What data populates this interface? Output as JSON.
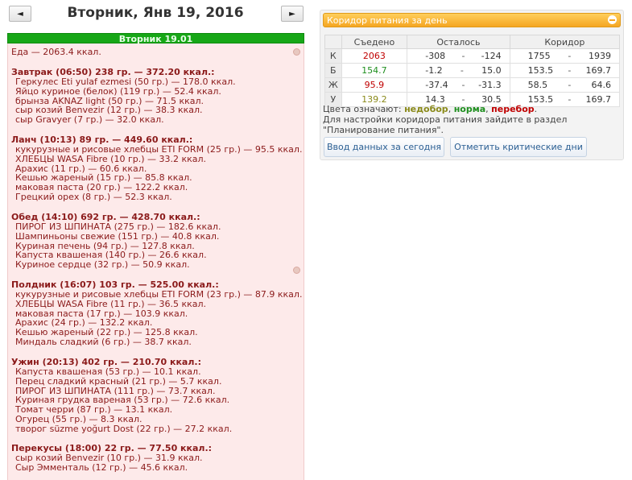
{
  "nav": {
    "prev_symbol": "◄",
    "next_symbol": "►",
    "title": "Вторник, Янв 19, 2016"
  },
  "day": {
    "header": "Вторник 19.01",
    "total": "Еда — 2063.4 ккал.",
    "meals": [
      {
        "title": "Завтрак (06:50) 238 гр. — 372.20 ккал.:",
        "items": [
          "Геркулес Eti yulaf ezmesi (50 гр.) — 178.0 ккал.",
          "Яйцо куриное (белок) (119 гр.) — 52.4 ккал.",
          "брынза AKNAZ light (50 гр.) — 71.5 ккал.",
          "сыр козий Benvezir (12 гр.) — 38.3 ккал.",
          "сыр Gravyer (7 гр.) — 32.0 ккал."
        ]
      },
      {
        "title": "Ланч (10:13) 89 гр. — 449.60 ккал.:",
        "items": [
          "кукурузные и рисовые хлебцы ETI FORM (25 гр.) — 95.5 ккал.",
          "ХЛЕБЦЫ WASA Fibre (10 гр.) — 33.2 ккал.",
          "Арахис (11 гр.) — 60.6 ккал.",
          "Кешью жареный (15 гр.) — 85.8 ккал.",
          "маковая паста (20 гр.) — 122.2 ккал.",
          "Грецкий орех (8 гр.) — 52.3 ккал."
        ]
      },
      {
        "title": "Обед (14:10) 692 гр. — 428.70 ккал.:",
        "items": [
          "ПИРОГ ИЗ ШПИНАТА (275 гр.) — 182.6 ккал.",
          "Шампиньоны свежие (151 гр.) — 40.8 ккал.",
          "Куриная печень (94 гр.) — 127.8 ккал.",
          "Капуста квашеная (140 гр.) — 26.6 ккал.",
          "Куриное сердце (32 гр.) — 50.9 ккал."
        ]
      },
      {
        "title": "Полдник (16:07) 103 гр. — 525.00 ккал.:",
        "items": [
          "кукурузные и рисовые хлебцы ETI FORM (23 гр.) — 87.9 ккал.",
          "ХЛЕБЦЫ WASA Fibre (11 гр.) — 36.5 ккал.",
          "маковая паста (17 гр.) — 103.9 ккал.",
          "Арахис (24 гр.) — 132.2 ккал.",
          "Кешью жареный (22 гр.) — 125.8 ккал.",
          "Миндаль сладкий (6 гр.) — 38.7 ккал."
        ]
      },
      {
        "title": "Ужин (20:13) 402 гр. — 210.70 ккал.:",
        "items": [
          "Капуста квашеная (53 гр.) — 10.1 ккал.",
          "Перец сладкий красный (21 гр.) — 5.7 ккал.",
          "ПИРОГ ИЗ ШПИНАТА (111 гр.) — 73.7 ккал.",
          "Куриная грудка вареная (53 гр.) — 72.6 ккал.",
          "Томат черри (87 гр.) — 13.1 ккал.",
          "Огурец (55 гр.) — 8.3 ккал.",
          "творог süzme yoğurt Dost (22 гр.) — 27.2 ккал."
        ]
      },
      {
        "title": "Перекусы (18:00) 22 гр. — 77.50 ккал.:",
        "items": [
          "сыр козий Benvezir (10 гр.) — 31.9 ккал.",
          "Сыр Эмменталь (12 гр.) — 45.6 ккал."
        ]
      }
    ]
  },
  "panel": {
    "title": "Коридор питания за день",
    "columns": {
      "eaten": "Съедено",
      "remaining": "Осталось",
      "corridor": "Коридор"
    },
    "rows": [
      {
        "label": "К",
        "eaten": "2063",
        "eaten_color": "#c00000",
        "rem_min": "-308",
        "rem_max": "-124",
        "cor_min": "1755",
        "cor_max": "1939"
      },
      {
        "label": "Б",
        "eaten": "154.7",
        "eaten_color": "#1f8f1f",
        "rem_min": "-1.2",
        "rem_max": "15.0",
        "cor_min": "153.5",
        "cor_max": "169.7"
      },
      {
        "label": "Ж",
        "eaten": "95.9",
        "eaten_color": "#c00000",
        "rem_min": "-37.4",
        "rem_max": "-31.3",
        "cor_min": "58.5",
        "cor_max": "64.6"
      },
      {
        "label": "У",
        "eaten": "139.2",
        "eaten_color": "#8a8a1a",
        "rem_min": "14.3",
        "rem_max": "30.5",
        "cor_min": "153.5",
        "cor_max": "169.7"
      }
    ],
    "dash": "-",
    "legend": {
      "prefix": "Цвета означают: ",
      "under": "недобор",
      "sep1": ", ",
      "norm": "норма",
      "sep2": ", ",
      "over": "перебор",
      "end": ".",
      "line2": "Для настройки коридора питания зайдите в раздел",
      "line3": "\"Планирование питания\"."
    },
    "button_today": "Ввод данных за сегодня",
    "button_critical": "Отметить критические дни",
    "colors": {
      "header": "#f5a623",
      "under": "#8a8a1a",
      "norm": "#1f8f1f",
      "over": "#c00000"
    }
  }
}
